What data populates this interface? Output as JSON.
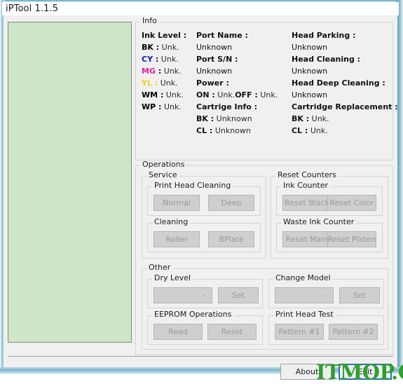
{
  "window": {
    "title": "iPTool 1.1.5"
  },
  "preview": {
    "name": "preview-area"
  },
  "info": {
    "legend": "Info",
    "ink_level_label": "Ink Level :",
    "inks": [
      {
        "code": "BK",
        "sep": ":",
        "value": "Unk.",
        "color": "#000000"
      },
      {
        "code": "CY",
        "sep": ":",
        "value": "Unk.",
        "color": "#1414c8"
      },
      {
        "code": "MG",
        "sep": ":",
        "value": "Unk.",
        "color": "#e81ea0"
      },
      {
        "code": "YL",
        "sep": ":",
        "value": "Unk.",
        "color": "#f2d21e"
      },
      {
        "code": "WM",
        "sep": ":",
        "value": "Unk.",
        "color": "#000000"
      },
      {
        "code": "WP",
        "sep": ":",
        "value": "Unk.",
        "color": "#000000"
      }
    ],
    "port_name_label": "Port Name :",
    "port_name_value": "Unknown",
    "port_sn_label": "Port S/N :",
    "port_sn_value": "Unknown",
    "power_label": "Power :",
    "power_on_label": "ON :",
    "power_on_value": "Unk.",
    "power_off_label": "OFF :",
    "power_off_value": "Unk.",
    "cartrige_info_label": "Cartrige Info :",
    "cartrige_bk_label": "BK :",
    "cartrige_bk_value": "Unknown",
    "cartrige_cl_label": "CL :",
    "cartrige_cl_value": "Unknown",
    "head_parking_label": "Head Parking :",
    "head_parking_value": "Unknown",
    "head_cleaning_label": "Head Cleaning :",
    "head_cleaning_value": "Unknown",
    "head_deep_cleaning_label": "Head Deep Cleaning :",
    "head_deep_cleaning_value": "Unknown",
    "cartridge_replacement_label": "Cartridge Replacement :",
    "replacement_bk_label": "BK :",
    "replacement_bk_value": "Unk.",
    "replacement_cl_label": "CL :",
    "replacement_cl_value": "Unk."
  },
  "operations": {
    "legend": "Operations",
    "service": {
      "legend": "Service",
      "print_head_cleaning": {
        "legend": "Print Head Cleaning",
        "normal_button": "Normal",
        "deep_button": "Deep"
      },
      "cleaning": {
        "legend": "Cleaning",
        "roller_button": "Roller",
        "bplate_button": "BPlate"
      }
    },
    "reset_counters": {
      "legend": "Reset Counters",
      "ink_counter": {
        "legend": "Ink Counter",
        "reset_black_button": "Reset Black",
        "reset_color_button": "Reset Color"
      },
      "waste_ink_counter": {
        "legend": "Waste Ink Counter",
        "reset_main_button": "Reset Main",
        "reset_platen_button": "Reset Platen"
      }
    },
    "other": {
      "legend": "Other",
      "dry_level": {
        "legend": "Dry Level",
        "combo_value": "",
        "set_button": "Set"
      },
      "change_model": {
        "legend": "Change Model",
        "combo_value": "",
        "set_button": "Set"
      },
      "eeprom": {
        "legend": "EEPROM Operations",
        "read_button": "Read",
        "reset_button": "Reset"
      },
      "print_head_test": {
        "legend": "Print Head Test",
        "pattern1_button": "Pattern #1",
        "pattern2_button": "Pattern #2"
      }
    }
  },
  "footer": {
    "about_button": "About",
    "exit_button": "Exit"
  },
  "watermark": {
    "text": "ITMOP.COM",
    "color": "#2f9e32"
  },
  "icons": {
    "chevron_down": "⌄"
  }
}
